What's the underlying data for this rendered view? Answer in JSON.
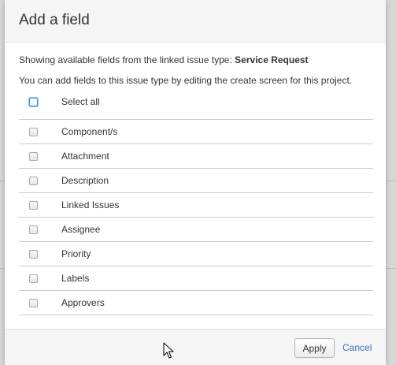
{
  "dialog": {
    "title": "Add a field",
    "info_prefix": "Showing available fields from the linked issue type:",
    "issue_type": "Service Request",
    "info_line2": "You can add fields to this issue type by editing the create screen for this project."
  },
  "select_all": {
    "label": "Select all",
    "checked": false
  },
  "fields": [
    {
      "label": "Component/s",
      "checked": false
    },
    {
      "label": "Attachment",
      "checked": false
    },
    {
      "label": "Description",
      "checked": false
    },
    {
      "label": "Linked Issues",
      "checked": false
    },
    {
      "label": "Assignee",
      "checked": false
    },
    {
      "label": "Priority",
      "checked": false
    },
    {
      "label": "Labels",
      "checked": false
    },
    {
      "label": "Approvers",
      "checked": false
    }
  ],
  "footer": {
    "apply_label": "Apply",
    "cancel_label": "Cancel"
  },
  "colors": {
    "link": "#3b73af",
    "header_bg": "#f5f5f5",
    "divider": "#cccccc",
    "focus": "#4a90d9"
  },
  "icons": {
    "cursor": "mouse-pointer-icon",
    "checkbox": "checkbox-icon"
  }
}
